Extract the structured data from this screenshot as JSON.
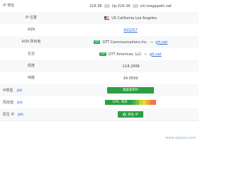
{
  "rows": {
    "ip": {
      "label": "IP 地址",
      "value_prefix": "216.36",
      "value_suffix": "(ip-216-36",
      "value_domain": "chi.megapath.net"
    },
    "location": {
      "label": "IP 位置",
      "value": "US California Los Angeles"
    },
    "asn": {
      "label": "ASN",
      "value": "AS3257"
    },
    "asn_owner": {
      "label": "ASN 所有者",
      "tag": "ISP",
      "value": "GTT Communications Inc.",
      "link": "gtt.net"
    },
    "company": {
      "label": "企业",
      "tag": "ISP",
      "value": "GTT Americas, LLC",
      "link": "gtt.net"
    },
    "longitude": {
      "label": "经度",
      "value": "-118.2666"
    },
    "latitude": {
      "label": "纬度",
      "value": "34.0559"
    },
    "ip_type": {
      "label": "IP类型",
      "help": "说明",
      "value": "家庭宽带IP"
    },
    "risk": {
      "label": "风控值",
      "help": "说明",
      "value": "19%",
      "text": "纯净",
      "level": 0.19
    },
    "native_ip": {
      "label": "原生 IP",
      "help": "说明",
      "value": "原生 IP"
    }
  },
  "watermark": "www.vpsxxs.com",
  "colors": {
    "green": "#2e9e43",
    "link": "#2f6fd6",
    "risk_high": "#ff6b6b"
  }
}
